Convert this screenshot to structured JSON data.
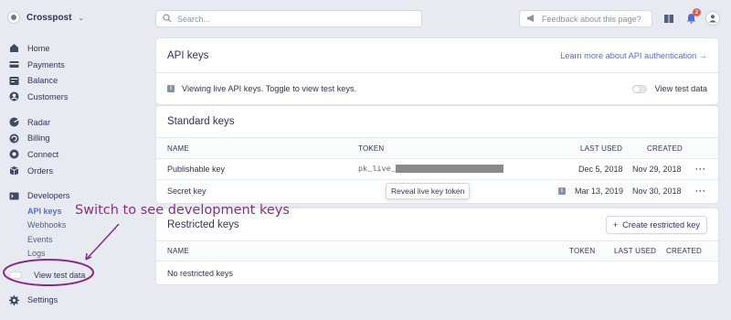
{
  "brand": {
    "name": "Crosspost"
  },
  "nav": {
    "main": [
      "Home",
      "Payments",
      "Balance",
      "Customers"
    ],
    "tools": [
      "Radar",
      "Billing",
      "Connect",
      "Orders"
    ],
    "developers": "Developers",
    "developer_sub": [
      "API keys",
      "Webhooks",
      "Events",
      "Logs"
    ],
    "view_test_data": "View test data",
    "settings": "Settings"
  },
  "topbar": {
    "search_placeholder": "Search...",
    "feedback": "Feedback about this page?",
    "notification_count": "2"
  },
  "api_keys": {
    "title": "API keys",
    "learn_more": "Learn more about API authentication →",
    "notice": "Viewing live API keys. Toggle to view test keys.",
    "toggle_label": "View test data"
  },
  "standard": {
    "title": "Standard keys",
    "headers": {
      "name": "NAME",
      "token": "TOKEN",
      "last_used": "LAST USED",
      "created": "CREATED"
    },
    "rows": [
      {
        "name": "Publishable key",
        "token": "pk_live_",
        "last_used": "Dec 5, 2018",
        "created": "Nov 29, 2018"
      },
      {
        "name": "Secret key",
        "token": "Reveal live key token",
        "last_used": "Mar 13, 2019",
        "created": "Nov 30, 2018"
      }
    ]
  },
  "restricted": {
    "title": "Restricted keys",
    "button": "Create restricted key",
    "headers": {
      "name": "NAME",
      "token": "TOKEN",
      "last_used": "LAST USED",
      "created": "CREATED"
    },
    "empty": "No restricted keys"
  },
  "annotation": {
    "text": "Switch to see development keys",
    "color": "#8a2b8c"
  },
  "colors": {
    "accent": "#556cd6",
    "badge": "#e25950",
    "background": "#e7eaf0"
  }
}
